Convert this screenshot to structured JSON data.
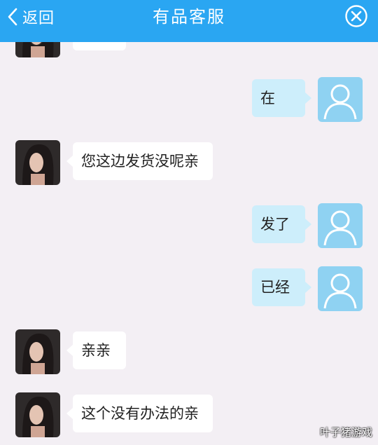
{
  "header": {
    "back_label": "返回",
    "title": "有品客服",
    "background_color": "#2aa6f2"
  },
  "colors": {
    "incoming_bubble": "#ffffff",
    "outgoing_bubble": "#cdeefb",
    "user_avatar_bg": "#8fd2f2",
    "chat_background": "#f3eff4"
  },
  "messages": [
    {
      "side": "incoming",
      "text": "",
      "avatar": "agent-photo-avatar"
    },
    {
      "side": "outgoing",
      "text": "在",
      "avatar": "user-default-avatar"
    },
    {
      "side": "incoming",
      "text": "您这边发货没呢亲",
      "avatar": "agent-photo-avatar"
    },
    {
      "side": "outgoing",
      "text": "发了",
      "avatar": "user-default-avatar"
    },
    {
      "side": "outgoing",
      "text": "已经",
      "avatar": "user-default-avatar"
    },
    {
      "side": "incoming",
      "text": "亲亲",
      "avatar": "agent-photo-avatar"
    },
    {
      "side": "incoming",
      "text": "这个没有办法的亲",
      "avatar": "agent-photo-avatar"
    }
  ],
  "watermark": "叶子猪游戏"
}
